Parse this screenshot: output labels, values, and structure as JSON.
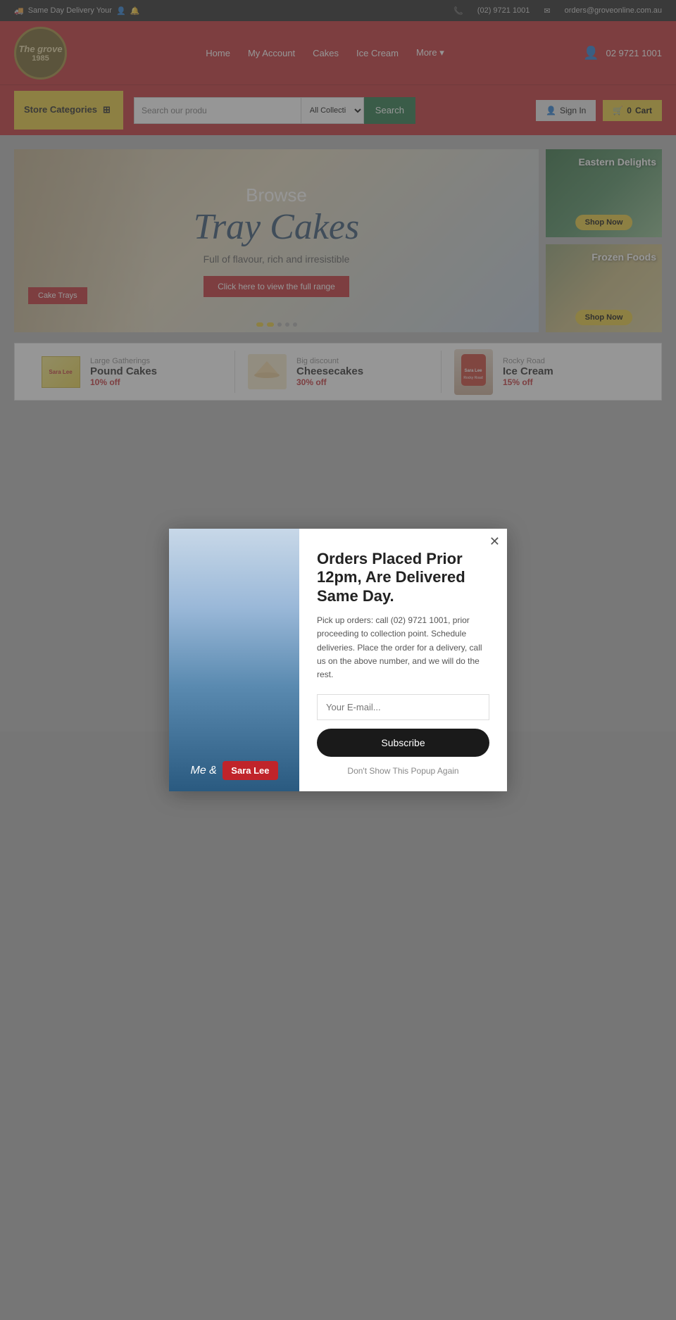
{
  "topbar": {
    "delivery_text": "Same Day Delivery Your",
    "phone": "(02) 9721 1001",
    "email": "orders@groveonline.com.au"
  },
  "header": {
    "logo_title": "The grove",
    "logo_sub": "1985",
    "nav": [
      "Home",
      "My Account",
      "Cakes",
      "Ice Cream",
      "More"
    ],
    "phone_display": "02 9721 1001"
  },
  "subheader": {
    "store_categories": "Store Categories",
    "search_placeholder": "Search our produ",
    "search_category": "All Collecti",
    "search_btn": "Search",
    "sign_in": "Sign In",
    "cart": "Cart",
    "cart_count": "0"
  },
  "hero": {
    "browse": "Browse",
    "tray": "Tray Cakes",
    "subtitle": "Full of flavour, rich and irresistible",
    "cta": "Click here to view the full range",
    "cake_trays_btn": "Cake Trays"
  },
  "side_banners": [
    {
      "title": "Eastern Delights",
      "btn": "Shop Now"
    },
    {
      "title": "Frozen Foods",
      "btn": "Shop Now"
    }
  ],
  "promo": [
    {
      "category": "Large Gatherings",
      "name": "Pound Cakes",
      "discount": "10% off"
    },
    {
      "category": "Big discount",
      "name": "Cheesecakes",
      "discount": "30% off"
    },
    {
      "category": "Rocky Road",
      "name": "Ice Cream",
      "discount": "15% off"
    }
  ],
  "popup": {
    "title": "Orders Placed Prior 12pm, Are Delivered Same Day.",
    "description": "Pick up orders: call (02) 9721 1001, prior proceeding to collection point. Schedule deliveries. Place the order for a delivery, call us on the above number, and we will do the rest.",
    "email_placeholder": "Your E-mail...",
    "subscribe_btn": "Subscribe",
    "no_show": "Don't Show This Popup Again",
    "sara_lee": "Sara Lee",
    "me_and": "Me &"
  }
}
